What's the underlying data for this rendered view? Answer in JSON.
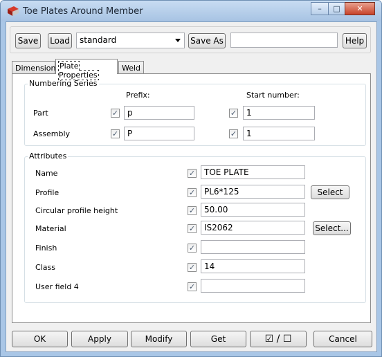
{
  "window": {
    "title": "Toe Plates Around Member",
    "min_glyph": "–",
    "max_glyph": "□",
    "close_glyph": "✕"
  },
  "toolbar": {
    "save_label": "Save",
    "load_label": "Load",
    "preset_value": "standard",
    "save_as_label": "Save As",
    "save_as_value": "",
    "help_label": "Help"
  },
  "tabs": [
    {
      "label": "Dimensions",
      "active": false
    },
    {
      "label": "Plate Properties",
      "active": true
    },
    {
      "label": "Weld",
      "active": false
    }
  ],
  "numbering": {
    "title": "Numbering Series",
    "prefix_header": "Prefix:",
    "start_header": "Start number:",
    "rows": [
      {
        "label": "Part",
        "prefix": "p",
        "start": "1",
        "prefix_checked": true,
        "start_checked": true
      },
      {
        "label": "Assembly",
        "prefix": "P",
        "start": "1",
        "prefix_checked": true,
        "start_checked": true
      }
    ]
  },
  "attributes": {
    "title": "Attributes",
    "rows": [
      {
        "label": "Name",
        "value": "TOE PLATE",
        "checked": true,
        "button": ""
      },
      {
        "label": "Profile",
        "value": "PL6*125",
        "checked": true,
        "button": "Select"
      },
      {
        "label": "Circular profile height",
        "value": "50.00",
        "checked": true,
        "button": ""
      },
      {
        "label": "Material",
        "value": "IS2062",
        "checked": true,
        "button": "Select..."
      },
      {
        "label": "Finish",
        "value": "",
        "checked": true,
        "button": ""
      },
      {
        "label": "Class",
        "value": "14",
        "checked": true,
        "button": ""
      },
      {
        "label": "User field 4",
        "value": "",
        "checked": true,
        "button": ""
      }
    ]
  },
  "footer": {
    "ok_label": "OK",
    "apply_label": "Apply",
    "modify_label": "Modify",
    "get_label": "Get",
    "toggle_checked_glyph": "☑",
    "toggle_separator": "/",
    "toggle_unchecked_glyph": "☐",
    "cancel_label": "Cancel"
  }
}
